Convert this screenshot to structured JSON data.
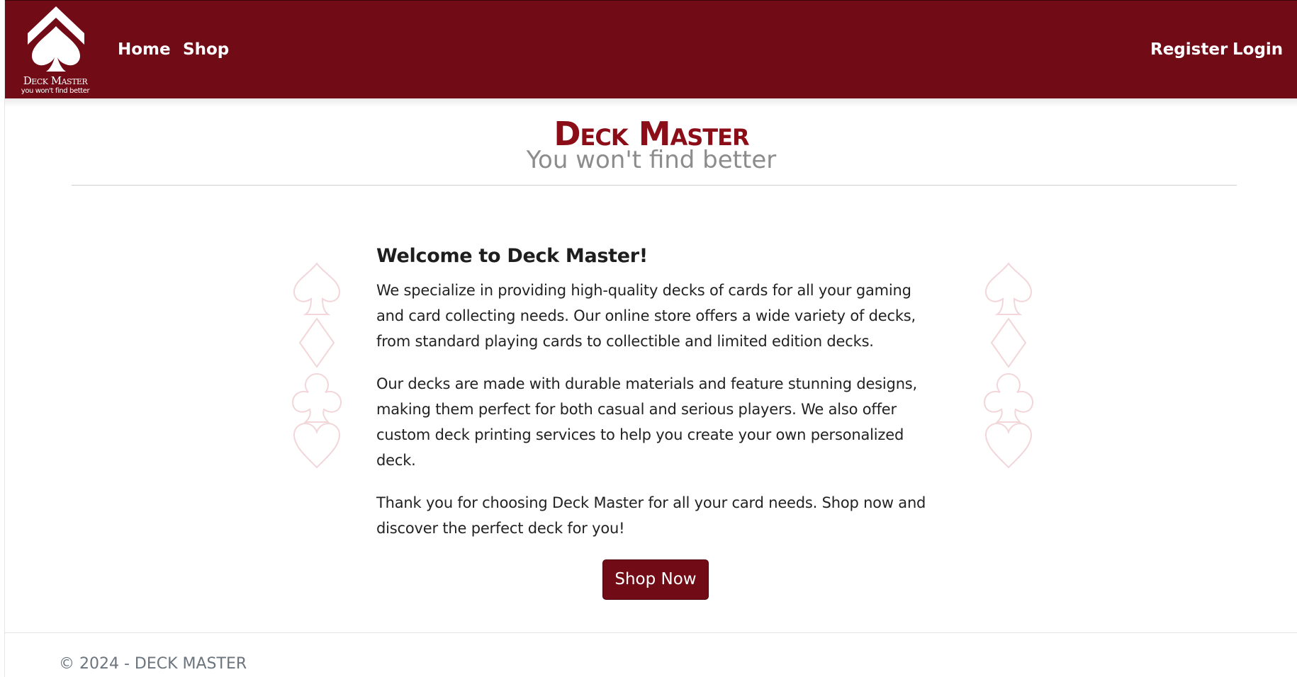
{
  "brand": {
    "name": "Deck Master",
    "tagline": "you won't find better"
  },
  "nav": {
    "left": [
      {
        "label": "Home"
      },
      {
        "label": "Shop"
      }
    ],
    "right": [
      {
        "label": "Register"
      },
      {
        "label": "Login"
      }
    ]
  },
  "hero": {
    "title": "Deck Master",
    "tagline": "You won't find better"
  },
  "content": {
    "heading": "Welcome to Deck Master!",
    "paragraphs": [
      "We specialize in providing high-quality decks of cards for all your gaming and card collecting needs. Our online store offers a wide variety of decks, from standard playing cards to collectible and limited edition decks.",
      "Our decks are made with durable materials and feature stunning designs, making them perfect for both casual and serious players. We also offer custom deck printing services to help you create your own personalized deck.",
      "Thank you for choosing Deck Master for all your card needs. Shop now and discover the perfect deck for you!"
    ],
    "button_label": "Shop Now"
  },
  "decor": {
    "suit_icons": [
      "spade-icon",
      "diamond-icon",
      "club-icon",
      "heart-icon"
    ],
    "suit_stroke_color": "#f2d6d9"
  },
  "footer": {
    "text": "© 2024 - DECK MASTER"
  },
  "colors": {
    "brand": "#710b16",
    "title": "#8a0d18",
    "tagline": "#8c8c8c",
    "footer_text": "#6c757d"
  }
}
